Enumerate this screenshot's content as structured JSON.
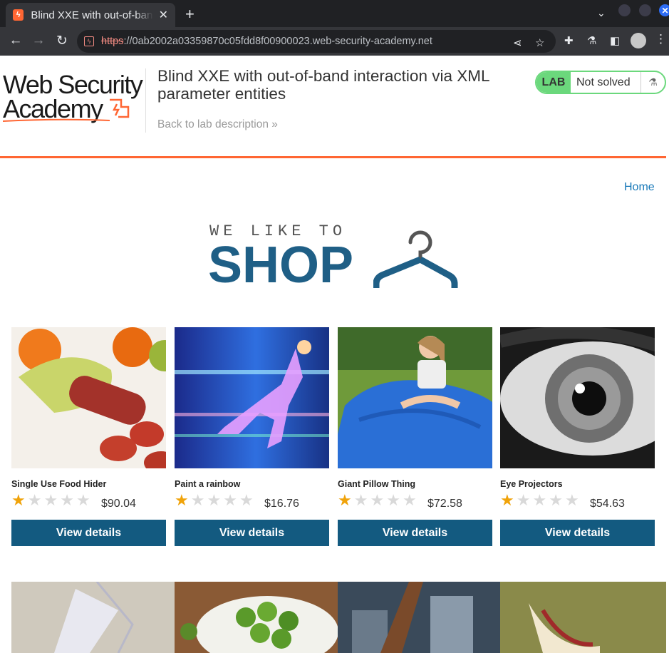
{
  "browser": {
    "tab_title": "Blind XXE with out-of-band interaction via XML parameter entities",
    "url_scheme": "https",
    "url_rest": "://0ab2002a03359870c05fdd8f00900023.web-security-academy.net"
  },
  "lab": {
    "logo_line1": "Web Security",
    "logo_line2": "Academy",
    "title": "Blind XXE with out-of-band interaction via XML parameter entities",
    "back_link": "Back to lab description",
    "badge": "LAB",
    "status": "Not solved"
  },
  "nav": {
    "home": "Home"
  },
  "shop_logo": {
    "tagline": "WE LIKE TO",
    "word": "SHOP"
  },
  "products": [
    {
      "name": "Single Use Food Hider",
      "rating": 1,
      "price": "$90.04",
      "button": "View details"
    },
    {
      "name": "Paint a rainbow",
      "rating": 1,
      "price": "$16.76",
      "button": "View details"
    },
    {
      "name": "Giant Pillow Thing",
      "rating": 1,
      "price": "$72.58",
      "button": "View details"
    },
    {
      "name": "Eye Projectors",
      "rating": 1,
      "price": "$54.63",
      "button": "View details"
    }
  ],
  "colors": {
    "accent": "#ff6633",
    "button": "#135a80",
    "lab_green": "#6bd87c",
    "star": "#f0a30a"
  }
}
